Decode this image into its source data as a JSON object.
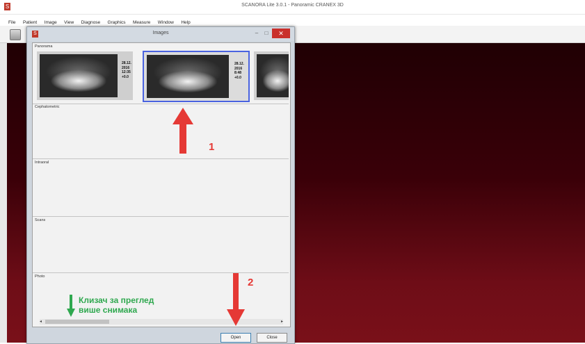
{
  "window": {
    "title": "SCANORA Lite 3.0.1 - Panoramic CRANEX 3D"
  },
  "menu": [
    "File",
    "Patient",
    "Image",
    "View",
    "Diagnose",
    "Graphics",
    "Measure",
    "Window",
    "Help"
  ],
  "dialog": {
    "title": "Images",
    "sections": {
      "panorama": "Panorama",
      "cephalometric": "Cephalometric",
      "intraoral": "Intraoral",
      "scans": "Scans",
      "photo": "Photo"
    },
    "thumbnails": [
      {
        "meta": [
          "28.12.",
          "2016",
          "12:35",
          "+0.0"
        ]
      },
      {
        "meta": [
          "28.12.",
          "2016",
          "8:48",
          "+0.0"
        ]
      }
    ],
    "buttons": {
      "open": "Open",
      "close": "Close"
    }
  },
  "annotations": {
    "step1": "1",
    "step2": "2",
    "note_line1": "Клизач за преглед",
    "note_line2": "више снимака"
  },
  "colors": {
    "accent_red": "#e53935",
    "note_green": "#2fa84f",
    "selection_blue": "#4a63e0"
  }
}
